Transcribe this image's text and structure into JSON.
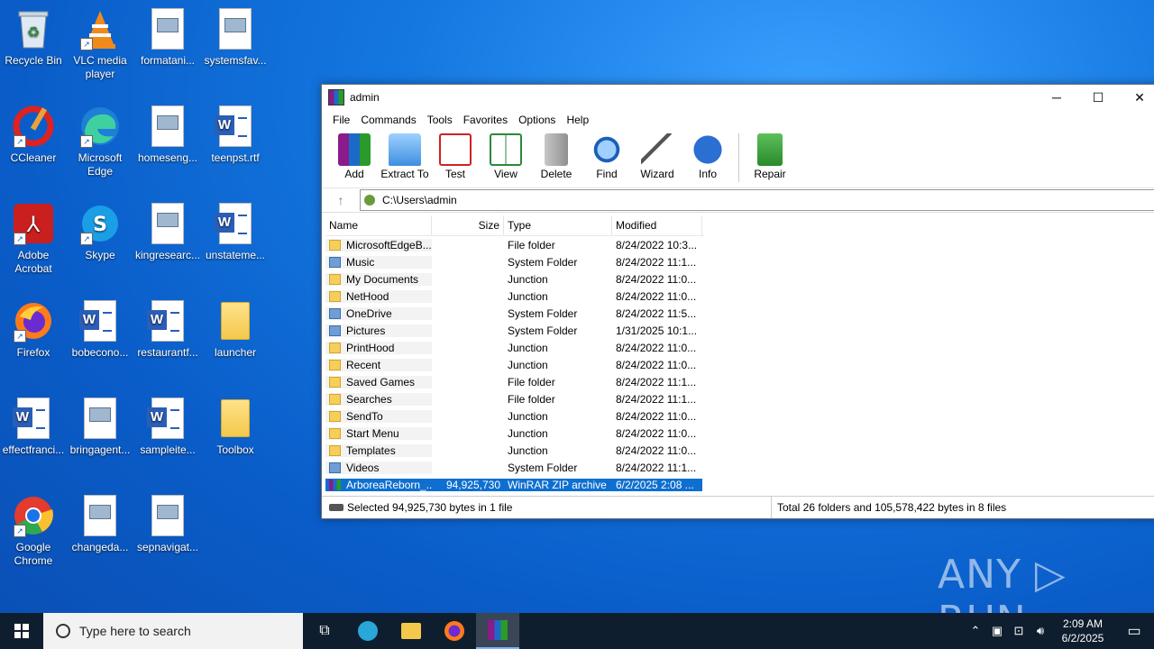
{
  "desktop": {
    "icons": [
      {
        "label": "Recycle Bin"
      },
      {
        "label": "VLC media player"
      },
      {
        "label": "formatani..."
      },
      {
        "label": "systemsfav..."
      },
      {
        "label": "CCleaner"
      },
      {
        "label": "Microsoft Edge"
      },
      {
        "label": "homeseng..."
      },
      {
        "label": "teenpst.rtf"
      },
      {
        "label": "Adobe Acrobat"
      },
      {
        "label": "Skype"
      },
      {
        "label": "kingresearc..."
      },
      {
        "label": "unstateme..."
      },
      {
        "label": "Firefox"
      },
      {
        "label": "bobecono..."
      },
      {
        "label": "restaurantf..."
      },
      {
        "label": "launcher"
      },
      {
        "label": "effectfranci..."
      },
      {
        "label": "bringagent..."
      },
      {
        "label": "sampleite..."
      },
      {
        "label": "Toolbox"
      },
      {
        "label": "Google Chrome"
      },
      {
        "label": "changeda..."
      },
      {
        "label": "sepnavigat..."
      }
    ]
  },
  "window": {
    "title": "admin",
    "controls": {
      "minimize": "─",
      "maximize": "☐",
      "close": "✕"
    },
    "menu": [
      "File",
      "Commands",
      "Tools",
      "Favorites",
      "Options",
      "Help"
    ],
    "toolbar": [
      "Add",
      "Extract To",
      "Test",
      "View",
      "Delete",
      "Find",
      "Wizard",
      "Info",
      "Repair"
    ],
    "path": "C:\\Users\\admin",
    "columns": {
      "name": "Name",
      "size": "Size",
      "type": "Type",
      "modified": "Modified"
    },
    "files": [
      {
        "name": "MicrosoftEdgeB...",
        "size": "",
        "type": "File folder",
        "modified": "8/24/2022 10:3..."
      },
      {
        "name": "Music",
        "size": "",
        "type": "System Folder",
        "modified": "8/24/2022 11:1..."
      },
      {
        "name": "My Documents",
        "size": "",
        "type": "Junction",
        "modified": "8/24/2022 11:0..."
      },
      {
        "name": "NetHood",
        "size": "",
        "type": "Junction",
        "modified": "8/24/2022 11:0..."
      },
      {
        "name": "OneDrive",
        "size": "",
        "type": "System Folder",
        "modified": "8/24/2022 11:5..."
      },
      {
        "name": "Pictures",
        "size": "",
        "type": "System Folder",
        "modified": "1/31/2025 10:1..."
      },
      {
        "name": "PrintHood",
        "size": "",
        "type": "Junction",
        "modified": "8/24/2022 11:0..."
      },
      {
        "name": "Recent",
        "size": "",
        "type": "Junction",
        "modified": "8/24/2022 11:0..."
      },
      {
        "name": "Saved Games",
        "size": "",
        "type": "File folder",
        "modified": "8/24/2022 11:1..."
      },
      {
        "name": "Searches",
        "size": "",
        "type": "File folder",
        "modified": "8/24/2022 11:1..."
      },
      {
        "name": "SendTo",
        "size": "",
        "type": "Junction",
        "modified": "8/24/2022 11:0..."
      },
      {
        "name": "Start Menu",
        "size": "",
        "type": "Junction",
        "modified": "8/24/2022 11:0..."
      },
      {
        "name": "Templates",
        "size": "",
        "type": "Junction",
        "modified": "8/24/2022 11:0..."
      },
      {
        "name": "Videos",
        "size": "",
        "type": "System Folder",
        "modified": "8/24/2022 11:1..."
      },
      {
        "name": "ArboreaReborn_...",
        "size": "94,925,730",
        "type": "WinRAR ZIP archive",
        "modified": "6/2/2025 2:08 ..."
      }
    ],
    "status_left": "Selected 94,925,730 bytes in 1 file",
    "status_right": "Total 26 folders and 105,578,422 bytes in 8 files"
  },
  "taskbar": {
    "search_placeholder": "Type here to search",
    "time": "2:09 AM",
    "date": "6/2/2025"
  },
  "watermark": "ANY ▷ RUN"
}
